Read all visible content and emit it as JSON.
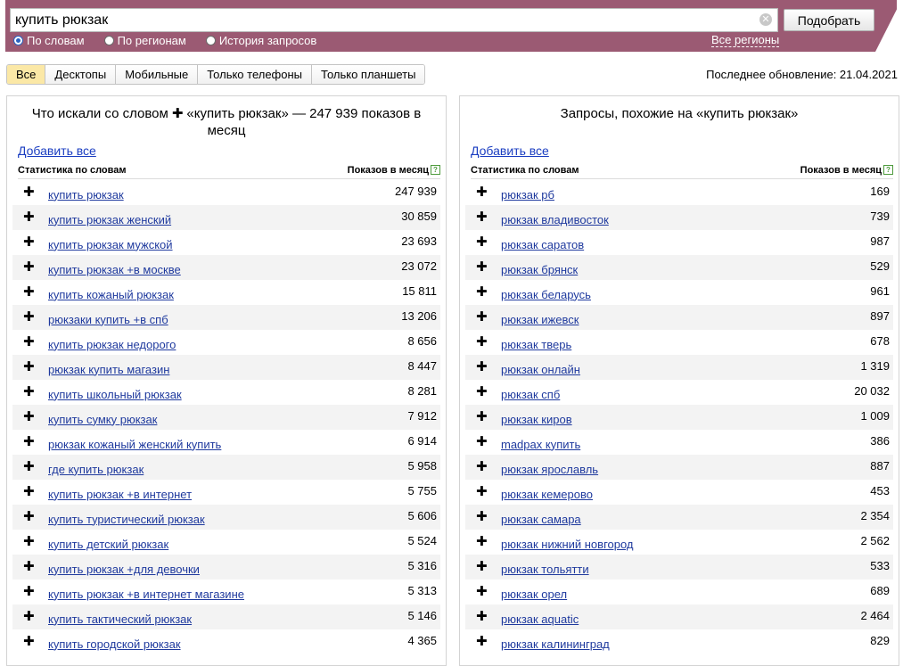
{
  "search": {
    "query": "купить рюкзак",
    "submit_label": "Подобрать",
    "clear_icon": "close-icon"
  },
  "modes": [
    {
      "label": "По словам",
      "selected": true
    },
    {
      "label": "По регионам",
      "selected": false
    },
    {
      "label": "История запросов",
      "selected": false
    }
  ],
  "all_regions_label": "Все регионы",
  "device_tabs": [
    {
      "label": "Все",
      "active": true
    },
    {
      "label": "Десктопы",
      "active": false
    },
    {
      "label": "Мобильные",
      "active": false
    },
    {
      "label": "Только телефоны",
      "active": false
    },
    {
      "label": "Только планшеты",
      "active": false
    }
  ],
  "last_update": "Последнее обновление: 21.04.2021",
  "left_panel": {
    "title_prefix": "Что искали со словом",
    "title_rest": "«купить рюкзак» — 247 939 показов в месяц",
    "add_all": "Добавить все",
    "col_phrase": "Статистика по словам",
    "col_count": "Показов в месяц",
    "help_mark": "?",
    "rows": [
      {
        "phrase": "купить рюкзак",
        "count": "247 939"
      },
      {
        "phrase": "купить рюкзак женский",
        "count": "30 859"
      },
      {
        "phrase": "купить рюкзак мужской",
        "count": "23 693"
      },
      {
        "phrase": "купить рюкзак +в москве",
        "count": "23 072"
      },
      {
        "phrase": "купить кожаный рюкзак",
        "count": "15 811"
      },
      {
        "phrase": "рюкзаки купить +в спб",
        "count": "13 206"
      },
      {
        "phrase": "купить рюкзак недорого",
        "count": "8 656"
      },
      {
        "phrase": "рюкзак купить магазин",
        "count": "8 447"
      },
      {
        "phrase": "купить школьный рюкзак",
        "count": "8 281"
      },
      {
        "phrase": "купить сумку рюкзак",
        "count": "7 912"
      },
      {
        "phrase": "рюкзак кожаный женский купить",
        "count": "6 914"
      },
      {
        "phrase": "где купить рюкзак",
        "count": "5 958"
      },
      {
        "phrase": "купить рюкзак +в интернет",
        "count": "5 755"
      },
      {
        "phrase": "купить туристический рюкзак",
        "count": "5 606"
      },
      {
        "phrase": "купить детский рюкзак",
        "count": "5 524"
      },
      {
        "phrase": "купить рюкзак +для девочки",
        "count": "5 316"
      },
      {
        "phrase": "купить рюкзак +в интернет магазине",
        "count": "5 313"
      },
      {
        "phrase": "купить тактический рюкзак",
        "count": "5 146"
      },
      {
        "phrase": "купить городской рюкзак",
        "count": "4 365"
      }
    ]
  },
  "right_panel": {
    "title": "Запросы, похожие на «купить рюкзак»",
    "add_all": "Добавить все",
    "col_phrase": "Статистика по словам",
    "col_count": "Показов в месяц",
    "help_mark": "?",
    "rows": [
      {
        "phrase": "рюкзак рб",
        "count": "169"
      },
      {
        "phrase": "рюкзак владивосток",
        "count": "739"
      },
      {
        "phrase": "рюкзак саратов",
        "count": "987"
      },
      {
        "phrase": "рюкзак брянск",
        "count": "529"
      },
      {
        "phrase": "рюкзак беларусь",
        "count": "961"
      },
      {
        "phrase": "рюкзак ижевск",
        "count": "897"
      },
      {
        "phrase": "рюкзак тверь",
        "count": "678"
      },
      {
        "phrase": "рюкзак онлайн",
        "count": "1 319"
      },
      {
        "phrase": "рюкзак спб",
        "count": "20 032"
      },
      {
        "phrase": "рюкзак киров",
        "count": "1 009"
      },
      {
        "phrase": "madpax купить",
        "count": "386"
      },
      {
        "phrase": "рюкзак ярославль",
        "count": "887"
      },
      {
        "phrase": "рюкзак кемерово",
        "count": "453"
      },
      {
        "phrase": "рюкзак самара",
        "count": "2 354"
      },
      {
        "phrase": "рюкзак нижний новгород",
        "count": "2 562"
      },
      {
        "phrase": "рюкзак тольятти",
        "count": "533"
      },
      {
        "phrase": "рюкзак орел",
        "count": "689"
      },
      {
        "phrase": "рюкзак aquatic",
        "count": "2 464"
      },
      {
        "phrase": "рюкзак калининград",
        "count": "829"
      }
    ]
  },
  "colors": {
    "header_bg": "#9b5a73",
    "link": "#1f3a9e",
    "active_tab": "#fbe8a6"
  }
}
